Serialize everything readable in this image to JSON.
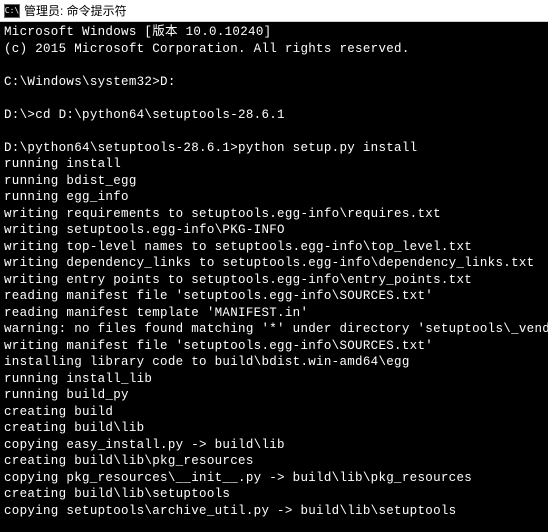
{
  "titlebar": {
    "icon_label": "C:\\",
    "title": "管理员: 命令提示符"
  },
  "terminal": {
    "lines": [
      "Microsoft Windows [版本 10.0.10240]",
      "(c) 2015 Microsoft Corporation. All rights reserved.",
      "",
      "C:\\Windows\\system32>D:",
      "",
      "D:\\>cd D:\\python64\\setuptools-28.6.1",
      "",
      "D:\\python64\\setuptools-28.6.1>python setup.py install",
      "running install",
      "running bdist_egg",
      "running egg_info",
      "writing requirements to setuptools.egg-info\\requires.txt",
      "writing setuptools.egg-info\\PKG-INFO",
      "writing top-level names to setuptools.egg-info\\top_level.txt",
      "writing dependency_links to setuptools.egg-info\\dependency_links.txt",
      "writing entry points to setuptools.egg-info\\entry_points.txt",
      "reading manifest file 'setuptools.egg-info\\SOURCES.txt'",
      "reading manifest template 'MANIFEST.in'",
      "warning: no files found matching '*' under directory 'setuptools\\_vendor'",
      "writing manifest file 'setuptools.egg-info\\SOURCES.txt'",
      "installing library code to build\\bdist.win-amd64\\egg",
      "running install_lib",
      "running build_py",
      "creating build",
      "creating build\\lib",
      "copying easy_install.py -> build\\lib",
      "creating build\\lib\\pkg_resources",
      "copying pkg_resources\\__init__.py -> build\\lib\\pkg_resources",
      "creating build\\lib\\setuptools",
      "copying setuptools\\archive_util.py -> build\\lib\\setuptools"
    ]
  }
}
